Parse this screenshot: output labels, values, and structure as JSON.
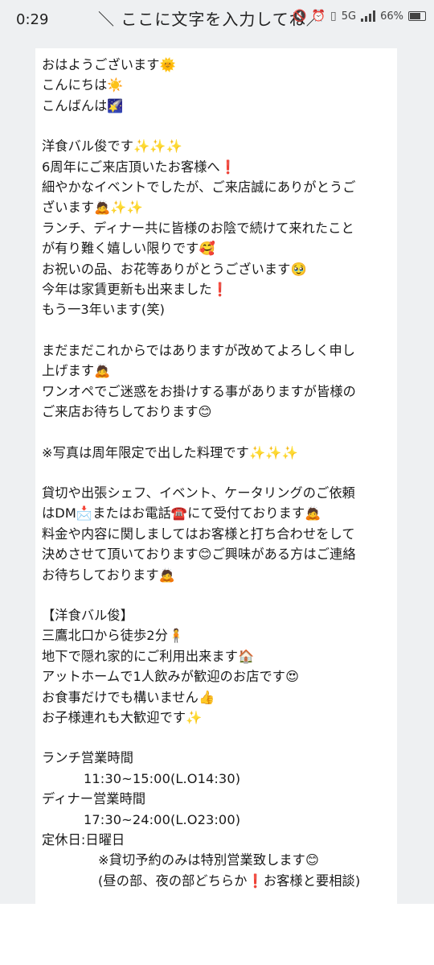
{
  "status_bar": {
    "time": "0:29",
    "overlay_text": "＼ ここに文字を入力してね／",
    "network": "5G",
    "battery": "66%"
  },
  "message": {
    "paragraphs": [
      [
        "おはようございます🌞",
        "こんにちは☀️",
        "こんばんは🌠"
      ],
      [
        "洋食バル俊です✨✨✨",
        "6周年にご来店頂いたお客様へ❗",
        "細やかなイベントでしたが、ご来店誠にありがとうご",
        "ざいます🙇✨✨",
        "ランチ、ディナー共に皆様のお陰で続けて来れたこと",
        "が有り難く嬉しい限りです🥰",
        "お祝いの品、お花等ありがとうございます🥹",
        "今年は家賃更新も出来ました❗",
        "もう一3年います(笑)"
      ],
      [
        "まだまだこれからではありますが改めてよろしく申し",
        "上げます🙇",
        "ワンオペでご迷惑をお掛けする事がありますが皆様の",
        "ご来店お待ちしております😊"
      ],
      [
        "※写真は周年限定で出した料理です✨✨✨"
      ],
      [
        "貸切や出張シェフ、イベント、ケータリングのご依頼",
        "はDM📩またはお電話☎️にて受付ております🙇",
        "料金や内容に関しましてはお客様と打ち合わせをして",
        "決めさせて頂いております😊ご興味がある方はご連絡",
        "お待ちしております🙇"
      ],
      [
        "【洋食バル俊】",
        "三鷹北口から徒歩2分🧍",
        "地下で隠れ家的にご利用出来ます🏠",
        "アットホームで1人飲みが歓迎のお店です😍",
        "お食事だけでも構いません👍",
        "お子様連れも大歓迎です✨"
      ]
    ],
    "hours": {
      "lunch_label": "ランチ営業時間",
      "lunch_time": "11:30~15:00(L.O14:30)",
      "dinner_label": "ディナー営業時間",
      "dinner_time": "17:30~24:00(L.O23:00)",
      "closed": "定休日:日曜日",
      "note1": "※貸切予約のみは特別営業致します😊",
      "note2": "(昼の部、夜の部どちらか❗お客様と要相談)"
    }
  }
}
